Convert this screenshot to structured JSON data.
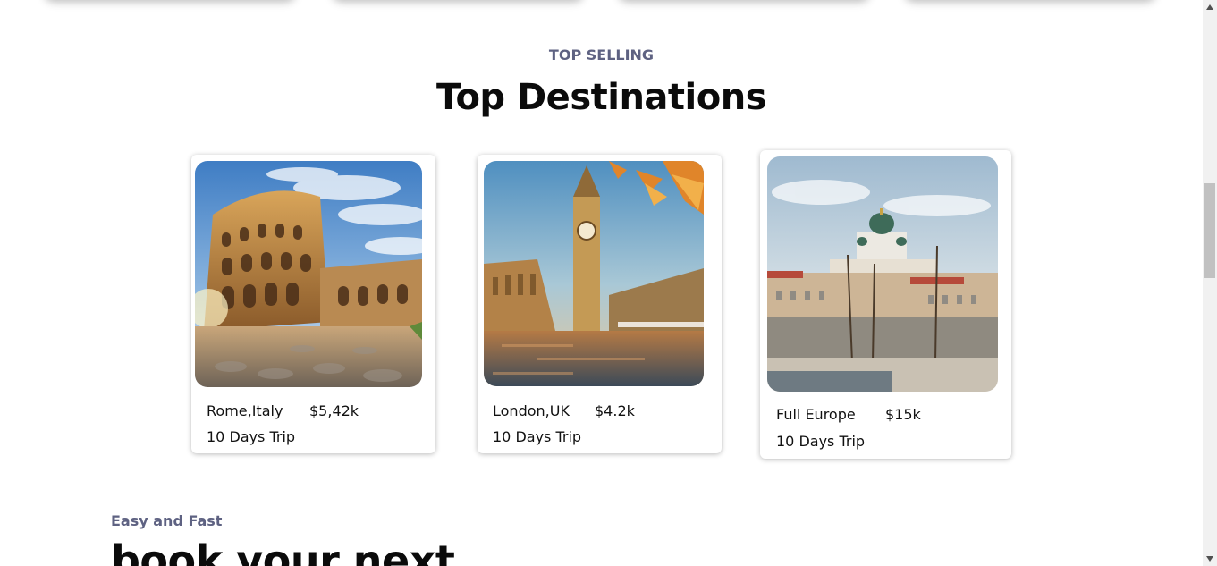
{
  "section": {
    "subtitle": "TOP SELLING",
    "title": "Top Destinations"
  },
  "destinations": [
    {
      "place": "Rome,Italy",
      "price": "$5,42k",
      "duration": "10 Days Trip",
      "image_icon": "colosseum-image"
    },
    {
      "place": "London,UK",
      "price": "$4.2k",
      "duration": "10 Days Trip",
      "image_icon": "big-ben-image"
    },
    {
      "place": "Full Europe",
      "price": "$15k",
      "duration": "10 Days Trip",
      "image_icon": "helsinki-cathedral-image"
    }
  ],
  "next_section": {
    "subtitle": "Easy and Fast",
    "title": "book your next"
  }
}
